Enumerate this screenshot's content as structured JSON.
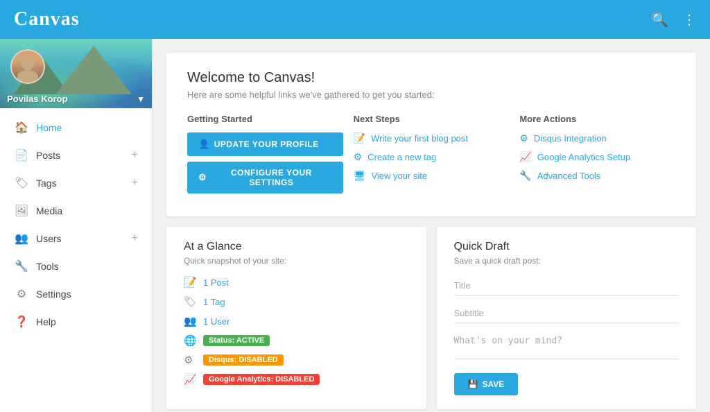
{
  "header": {
    "logo": "Canvas",
    "search_icon": "🔍",
    "menu_icon": "⋮"
  },
  "sidebar": {
    "user": {
      "name": "Povilas Korop",
      "chevron": "▼"
    },
    "nav_items": [
      {
        "id": "home",
        "label": "Home",
        "icon": "🏠",
        "has_plus": false,
        "active": true
      },
      {
        "id": "posts",
        "label": "Posts",
        "icon": "📄",
        "has_plus": true,
        "active": false
      },
      {
        "id": "tags",
        "label": "Tags",
        "icon": "🏷",
        "has_plus": true,
        "active": false
      },
      {
        "id": "media",
        "label": "Media",
        "icon": "🖼",
        "has_plus": false,
        "active": false
      },
      {
        "id": "users",
        "label": "Users",
        "icon": "👥",
        "has_plus": true,
        "active": false
      },
      {
        "id": "tools",
        "label": "Tools",
        "icon": "🔧",
        "has_plus": false,
        "active": false
      },
      {
        "id": "settings",
        "label": "Settings",
        "icon": "⚙",
        "has_plus": false,
        "active": false
      },
      {
        "id": "help",
        "label": "Help",
        "icon": "❓",
        "has_plus": false,
        "active": false
      }
    ]
  },
  "welcome": {
    "title": "Welcome to Canvas!",
    "subtitle": "Here are some helpful links we've gathered to get you started:",
    "getting_started": {
      "label": "Getting Started",
      "btn_profile": "UPDATE YOUR PROFILE",
      "btn_settings": "CONFIGURE YOUR SETTINGS",
      "profile_icon": "👤",
      "settings_icon": "⚙"
    },
    "next_steps": {
      "label": "Next Steps",
      "links": [
        {
          "text": "Write your first blog post",
          "icon": "📝"
        },
        {
          "text": "Create a new tag",
          "icon": "⚙"
        },
        {
          "text": "View your site",
          "icon": "🖥"
        }
      ]
    },
    "more_actions": {
      "label": "More Actions",
      "links": [
        {
          "text": "Disqus Integration",
          "icon": "⚙"
        },
        {
          "text": "Google Analytics Setup",
          "icon": "📈"
        },
        {
          "text": "Advanced Tools",
          "icon": "🔧"
        }
      ]
    }
  },
  "at_a_glance": {
    "title": "At a Glance",
    "subtitle": "Quick snapshot of your site:",
    "items": [
      {
        "type": "link",
        "text": "1 Post",
        "icon": "📝"
      },
      {
        "type": "link",
        "text": "1 Tag",
        "icon": "🏷"
      },
      {
        "type": "link",
        "text": "1 User",
        "icon": "👥"
      },
      {
        "type": "badge",
        "icon": "🌐",
        "badge_text": "Status: ACTIVE",
        "badge_class": "badge-green"
      },
      {
        "type": "badge",
        "icon": "⚙",
        "badge_text": "Disqus: DISABLED",
        "badge_class": "badge-orange"
      },
      {
        "type": "badge",
        "icon": "📈",
        "badge_text": "Google Analytics: DISABLED",
        "badge_class": "badge-red"
      }
    ]
  },
  "quick_draft": {
    "title": "Quick Draft",
    "subtitle": "Save a quick draft post:",
    "title_placeholder": "Title",
    "subtitle_placeholder": "Subtitle",
    "body_placeholder": "What's on your mind?",
    "save_label": "SAVE",
    "save_icon": "💾"
  }
}
